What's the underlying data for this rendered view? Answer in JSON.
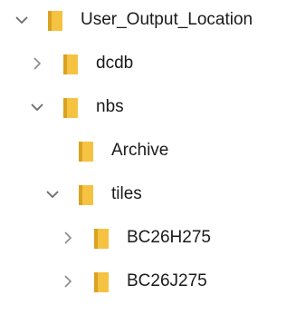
{
  "colors": {
    "folder_body": "#f5c242",
    "folder_shade": "#d9a221",
    "chevron": "#6b6b6b",
    "text": "#1a1a1a"
  },
  "tree": {
    "items": [
      {
        "label": "User_Output_Location",
        "state": "expanded",
        "icon": "folder-icon"
      },
      {
        "label": "dcdb",
        "state": "collapsed",
        "icon": "folder-icon"
      },
      {
        "label": "nbs",
        "state": "expanded",
        "icon": "folder-icon"
      },
      {
        "label": "Archive",
        "state": "leaf",
        "icon": "folder-icon"
      },
      {
        "label": "tiles",
        "state": "expanded",
        "icon": "folder-icon"
      },
      {
        "label": "BC26H275",
        "state": "collapsed",
        "icon": "folder-icon"
      },
      {
        "label": "BC26J275",
        "state": "collapsed",
        "icon": "folder-icon"
      }
    ]
  }
}
